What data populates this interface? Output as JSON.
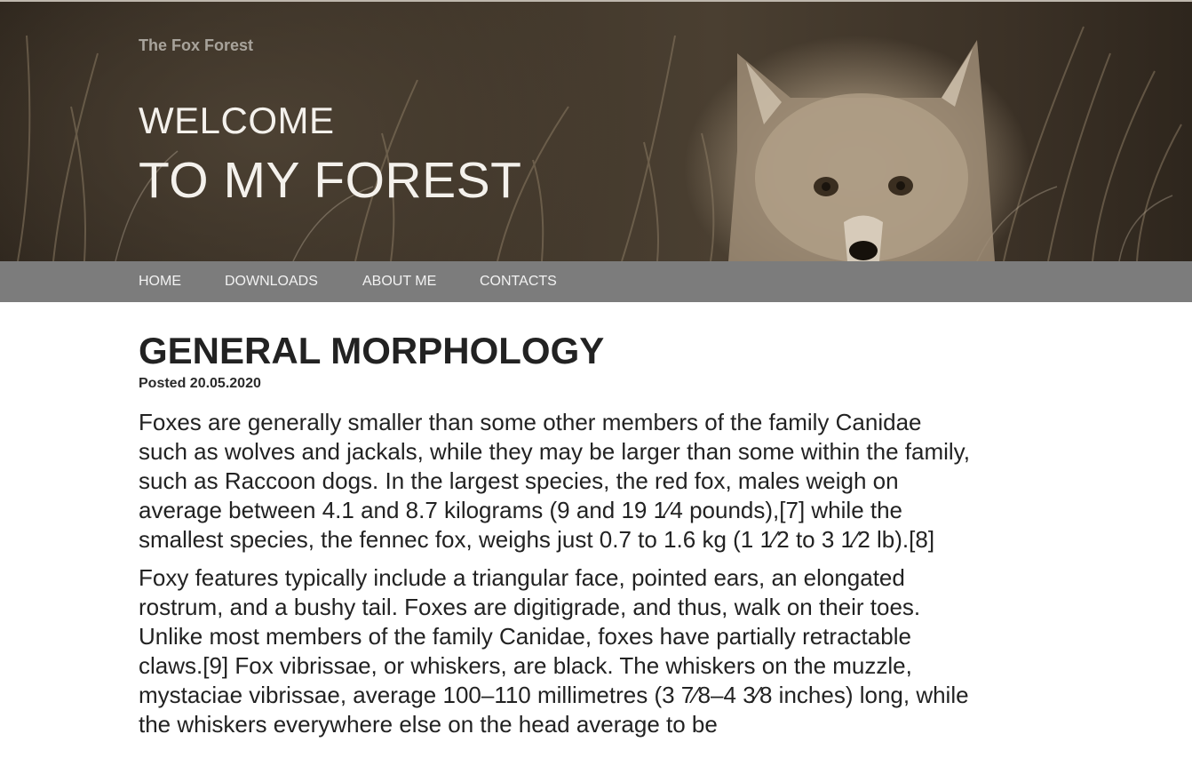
{
  "header": {
    "site_name": "The Fox Forest",
    "welcome_line1": "WELCOME",
    "welcome_line2": "TO MY FOREST"
  },
  "nav": {
    "items": [
      {
        "label": "HOME"
      },
      {
        "label": "DOWNLOADS"
      },
      {
        "label": "ABOUT ME"
      },
      {
        "label": "CONTACTS"
      }
    ]
  },
  "post": {
    "title": "GENERAL MORPHOLOGY",
    "meta": "Posted 20.05.2020",
    "paragraphs": [
      "Foxes are generally smaller than some other members of the family Canidae such as wolves and jackals, while they may be larger than some within the family, such as Raccoon dogs. In the largest species, the red fox, males weigh on average between 4.1 and 8.7 kilograms (9 and 19 1⁄4 pounds),[7] while the smallest species, the fennec fox, weighs just 0.7 to 1.6 kg (1 1⁄2 to 3 1⁄2 lb).[8]",
      "Foxy features typically include a triangular face, pointed ears, an elongated rostrum, and a bushy tail. Foxes are digitigrade, and thus, walk on their toes. Unlike most members of the family Canidae, foxes have partially retractable claws.[9] Fox vibrissae, or whiskers, are black. The whiskers on the muzzle, mystaciae vibrissae, average 100–110 millimetres (3 7⁄8–4 3⁄8 inches) long, while the whiskers everywhere else on the head average to be"
    ]
  },
  "colors": {
    "nav_background": "#7c7c7c",
    "hero_tone": "#4a3f31",
    "text": "#222222"
  }
}
